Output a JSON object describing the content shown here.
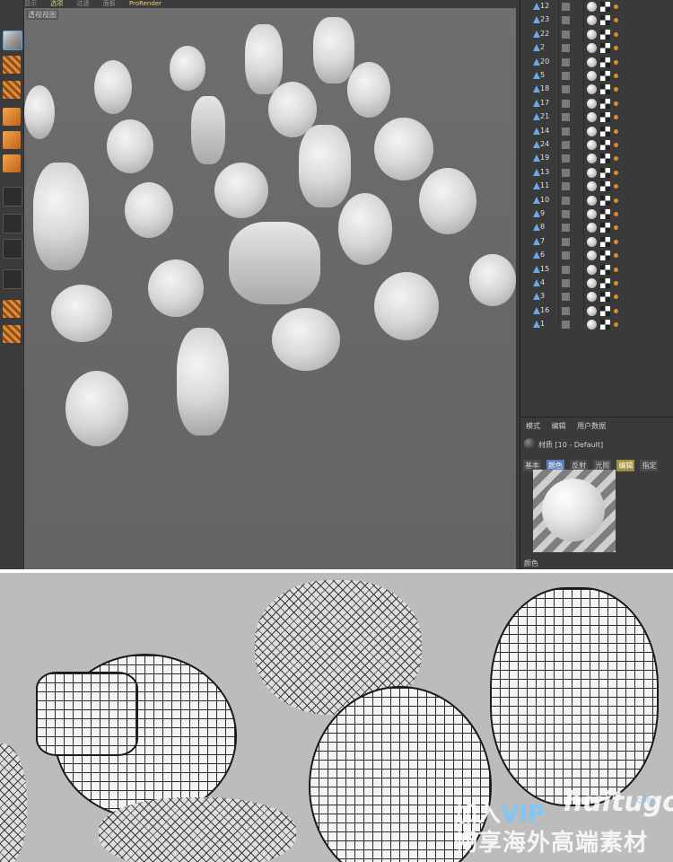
{
  "menubar": {
    "items": [
      "显示",
      "选项",
      "过滤",
      "面板",
      "ProRender"
    ],
    "active_index": 1
  },
  "viewport": {
    "label": "透视视图"
  },
  "object_list": {
    "rows": [
      "12",
      "23",
      "22",
      "2",
      "20",
      "5",
      "18",
      "17",
      "21",
      "14",
      "24",
      "19",
      "13",
      "11",
      "10",
      "9",
      "8",
      "7",
      "6",
      "15",
      "4",
      "3",
      "16",
      "1"
    ]
  },
  "attributes": {
    "tabs": [
      "模式",
      "编辑",
      "用户数据"
    ],
    "material_name": "材质 [10 - Default]",
    "channel_tabs": [
      "基本",
      "颜色",
      "反射",
      "光照",
      "编辑",
      "指定"
    ],
    "selected_channel": "颜色",
    "highlight_channel": "编辑",
    "color_label": "颜色"
  },
  "watermark": {
    "line1_prefix": "加入",
    "line1_vip": "VIP",
    "brand": "huitugou",
    "domain": ".com",
    "line2": "畅享海外高端素材"
  },
  "tools": [
    "cube-tool",
    "checker-tool",
    "grid-tool",
    "cube-tool",
    "cube-tool",
    "orange-cube-tool",
    "axis-tool",
    "spline-tool",
    "dollar-tool",
    "magnet-tool",
    "lock-tool",
    "refresh-tool"
  ]
}
